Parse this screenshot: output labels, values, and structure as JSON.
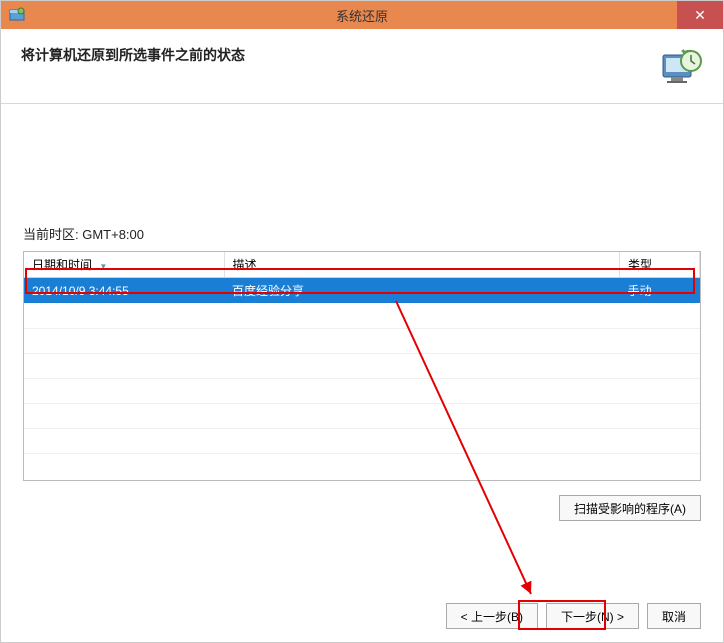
{
  "titlebar": {
    "title": "系统还原",
    "icon_alt": "restore-icon",
    "close_tooltip": "Close"
  },
  "header": {
    "title": "将计算机还原到所选事件之前的状态",
    "icon_alt": "system-restore-clock-icon"
  },
  "timezone_label": "当前时区: GMT+8:00",
  "table": {
    "columns": {
      "datetime": "日期和时间",
      "desc": "描述",
      "type": "类型"
    },
    "rows": [
      {
        "datetime": "2014/10/9 3:44:55",
        "desc": "百度经验分享",
        "type": "手动"
      }
    ]
  },
  "buttons": {
    "scan": "扫描受影响的程序(A)",
    "back": "< 上一步(B)",
    "next": "下一步(N) >",
    "cancel": "取消"
  }
}
